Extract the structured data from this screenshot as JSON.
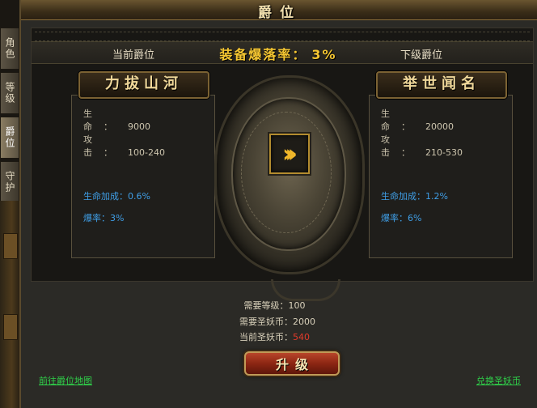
{
  "window": {
    "title": "爵位"
  },
  "side_tabs": [
    {
      "label": "角色"
    },
    {
      "label": "等级"
    },
    {
      "label": "爵位"
    },
    {
      "label": "守护"
    }
  ],
  "header": {
    "current_label": "当前爵位",
    "next_label": "下级爵位",
    "drop_rate_label": "装备爆落率：",
    "drop_rate_value": "3%"
  },
  "current_rank": {
    "name": "力拔山河",
    "hp_label": "生命：",
    "hp_value": "9000",
    "atk_label": "攻击：",
    "atk_value": "100-240",
    "hp_bonus_label": "生命加成：",
    "hp_bonus_value": "0.6%",
    "crit_label": "爆率：",
    "crit_value": "3%"
  },
  "next_rank": {
    "name": "举世闻名",
    "hp_label": "生命：",
    "hp_value": "20000",
    "atk_label": "攻击：",
    "atk_value": "210-530",
    "hp_bonus_label": "生命加成：",
    "hp_bonus_value": "1.2%",
    "crit_label": "爆率：",
    "crit_value": "6%"
  },
  "requirements": {
    "level_label": "需要等级：",
    "level_value": "100",
    "cost_label": "需要圣妖币：",
    "cost_value": "2000",
    "current_label": "当前圣妖币：",
    "current_value": "540"
  },
  "upgrade_button": {
    "label": "升级"
  },
  "links": {
    "go_map": "前往爵位地图",
    "exchange": "兑换圣妖币"
  },
  "colors": {
    "accent_gold": "#f4c531",
    "bonus_blue": "#3f9ee6",
    "link_green": "#2fd14a",
    "insufficient_red": "#e23a2a"
  }
}
